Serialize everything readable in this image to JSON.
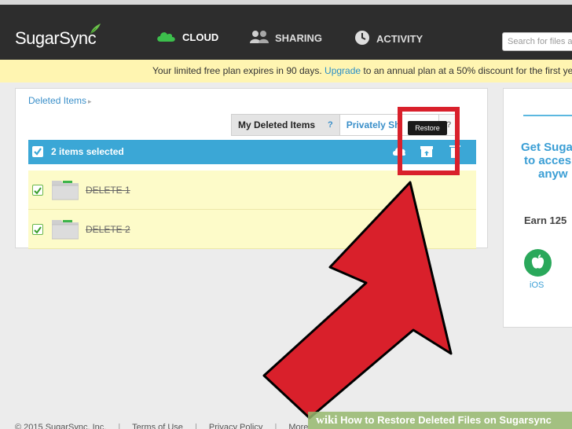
{
  "app": {
    "logo": "SugarSync"
  },
  "nav": [
    {
      "label": "CLOUD",
      "icon": "cloud-icon"
    },
    {
      "label": "SHARING",
      "icon": "users-icon"
    },
    {
      "label": "ACTIVITY",
      "icon": "clock-icon"
    }
  ],
  "search": {
    "placeholder": "Search for files a"
  },
  "promo": {
    "before": "Your limited free plan expires in 90 days.",
    "link": "Upgrade",
    "after": "to an annual plan at a 50% discount for the first yea"
  },
  "breadcrumb": {
    "label": "Deleted Items"
  },
  "tabs": {
    "mine": "My Deleted Items",
    "mine_help": "?",
    "shared": "Privately Sh",
    "shared_help": "?"
  },
  "selection": {
    "text": "2 items selected",
    "tooltip": "Restore"
  },
  "rows": [
    {
      "name": "DELETE 1",
      "checked": true
    },
    {
      "name": "DELETE 2",
      "checked": true
    }
  ],
  "right_panel": {
    "line1": "Get Suga",
    "line2": "to acces",
    "line3": "anyw",
    "earn": "Earn 125",
    "ios_label": "iOS"
  },
  "footer": {
    "copyright": "© 2015 SugarSync, Inc.",
    "terms": "Terms of Use",
    "privacy": "Privacy Policy",
    "more": "More"
  },
  "watermark": {
    "brand": "wiki",
    "title": "How to Restore Deleted Files on Sugarsync"
  },
  "colors": {
    "header_bg": "#2d2d2d",
    "accent_blue": "#3ba7d6",
    "promo_bg": "#fff5b1",
    "row_bg": "#fdfbc9",
    "highlight_red": "#d9202b",
    "ios_green": "#2aa85b"
  }
}
